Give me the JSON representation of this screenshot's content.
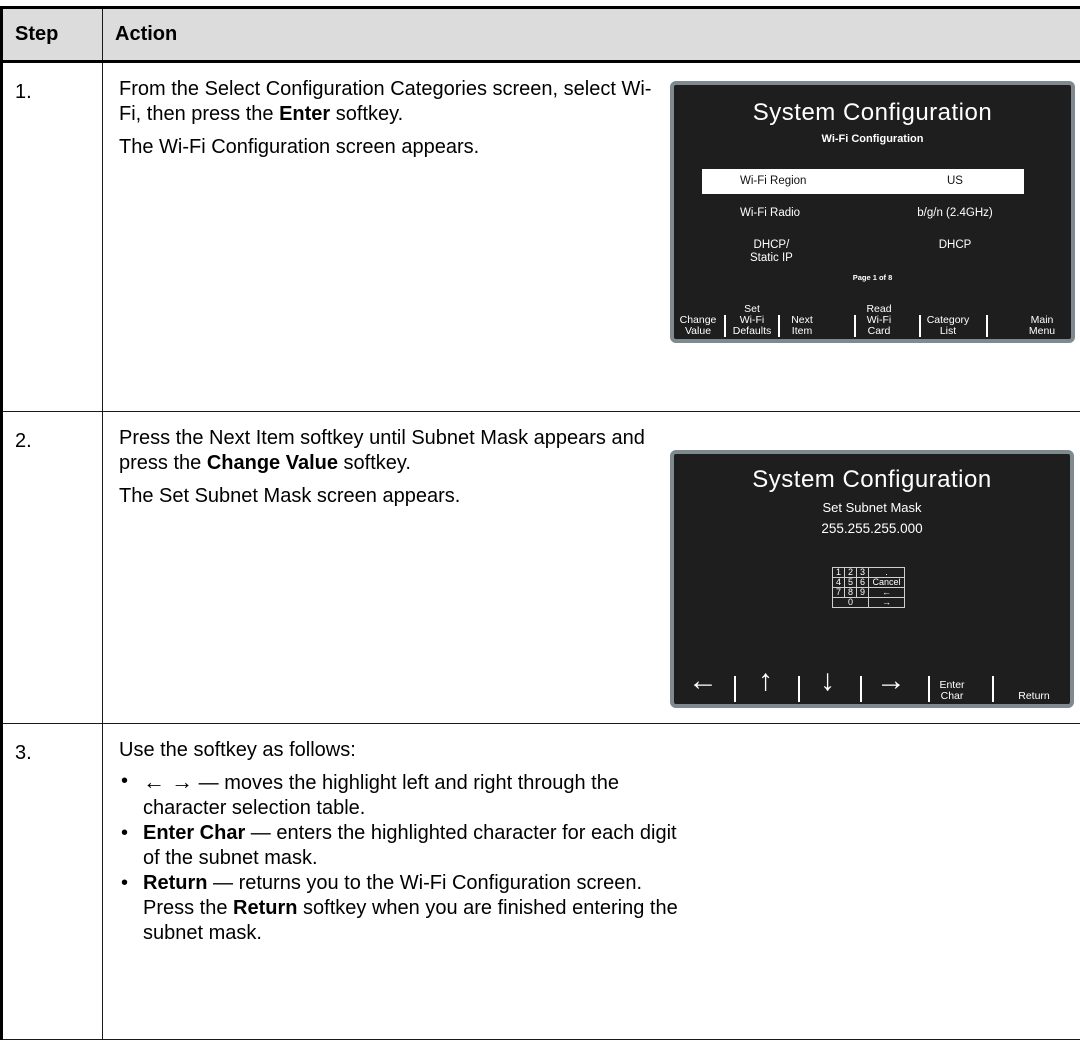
{
  "header": {
    "step": "Step",
    "action": "Action"
  },
  "rows": [
    {
      "num": "1.",
      "lines": [
        "From the Select Configuration Categories screen, select Wi-Fi, then press the",
        "Enter",
        "softkey.",
        "The Wi-Fi Configuration screen appears."
      ]
    },
    {
      "num": "2.",
      "lines": [
        "Press the Next Item softkey until Subnet Mask appears and press the",
        "Change Value",
        "softkey.",
        "The Set Subnet Mask screen appears."
      ]
    },
    {
      "num": "3.",
      "intro": "Use the softkey as follows:",
      "b1_arrows": "←   →",
      "b1_text": " — moves the highlight left and right through the character selection table.",
      "b2_bold": "Enter Char",
      "b2_text": " — enters the highlighted character for each digit of the subnet mask.",
      "b3_bold": "Return",
      "b3_text": " — returns you to the Wi-Fi Configuration screen. Press the ",
      "b3_bold2": "Return",
      "b3_text2": " softkey when you are finished entering the subnet mask."
    }
  ],
  "screen1": {
    "title": "System Configuration",
    "subtitle": "Wi-Fi Configuration",
    "items": [
      {
        "label": "Wi-Fi Region",
        "value": "US"
      },
      {
        "label": "Wi-Fi Radio",
        "value": "b/g/n (2.4GHz)"
      },
      {
        "label": "DHCP/\nStatic IP",
        "value": "DHCP"
      }
    ],
    "page": "Page 1 of 8",
    "softkeys": [
      "Change\nValue",
      "Set\nWi-Fi\nDefaults",
      "Next\nItem",
      "Read\nWi-Fi\nCard",
      "Category\nList",
      "Main\nMenu"
    ]
  },
  "screen2": {
    "title": "System Configuration",
    "subtitle": "Set Subnet Mask",
    "value": "255.255.255.000",
    "keypad": [
      [
        "1",
        "2",
        "3",
        "."
      ],
      [
        "4",
        "5",
        "6",
        "Cancel"
      ],
      [
        "7",
        "8",
        "9",
        "←"
      ],
      [
        "0",
        "→"
      ]
    ],
    "softkeys": [
      "←",
      "↑",
      "↓",
      "→",
      "Enter\nChar",
      "Return"
    ]
  }
}
